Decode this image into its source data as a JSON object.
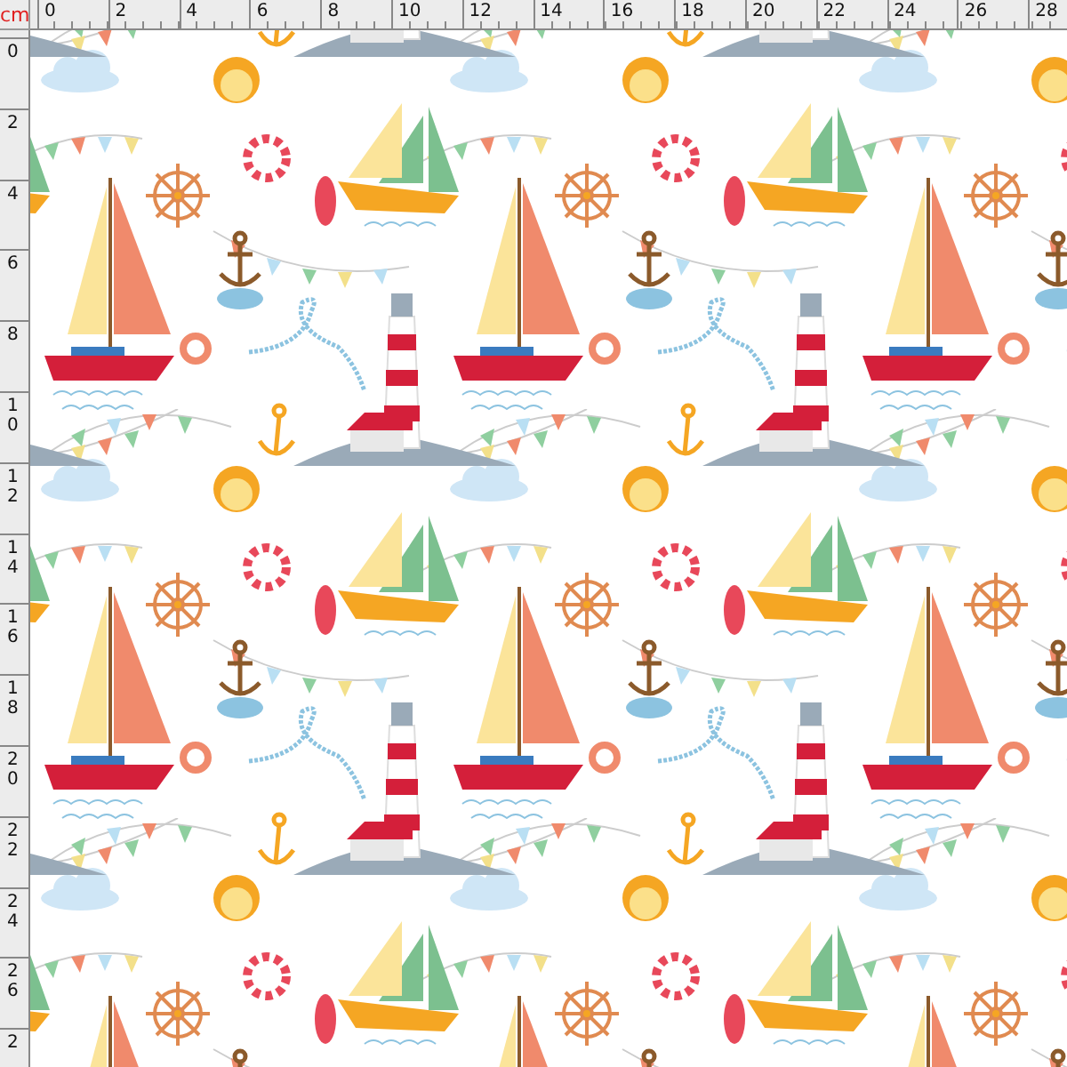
{
  "ruler": {
    "unit": "cm",
    "top_labels": [
      "0",
      "2",
      "4",
      "6",
      "8",
      "10",
      "12",
      "14",
      "16",
      "18",
      "20",
      "22",
      "24",
      "26",
      "28"
    ],
    "left_labels": [
      "0",
      "2",
      "4",
      "6",
      "8",
      "10",
      "12",
      "14",
      "16",
      "18",
      "20",
      "22",
      "24",
      "26",
      "2"
    ]
  }
}
